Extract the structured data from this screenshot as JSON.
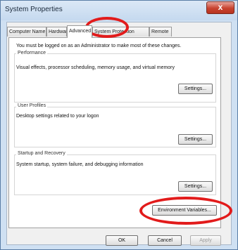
{
  "window": {
    "title": "System Properties",
    "close_glyph": "x"
  },
  "tabs": [
    {
      "label": "Computer Name",
      "active": false
    },
    {
      "label": "Hardware",
      "active": false
    },
    {
      "label": "Advanced",
      "active": true
    },
    {
      "label": "System Protection",
      "active": false
    },
    {
      "label": "Remote",
      "active": false
    }
  ],
  "advanced": {
    "notice": "You must be logged on as an Administrator to make most of these changes.",
    "performance": {
      "label": "Performance",
      "description": "Visual effects, processor scheduling, memory usage, and virtual memory",
      "button": "Settings..."
    },
    "user_profiles": {
      "label": "User Profiles",
      "description": "Desktop settings related to your logon",
      "button": "Settings..."
    },
    "startup_recovery": {
      "label": "Startup and Recovery",
      "description": "System startup, system failure, and debugging information",
      "button": "Settings..."
    },
    "env_button": "Environment Variables..."
  },
  "footer": {
    "ok": "OK",
    "cancel": "Cancel",
    "apply": "Apply"
  },
  "annotations": {
    "color": "#e21b1b",
    "highlighted": [
      "Advanced",
      "Environment Variables..."
    ]
  }
}
